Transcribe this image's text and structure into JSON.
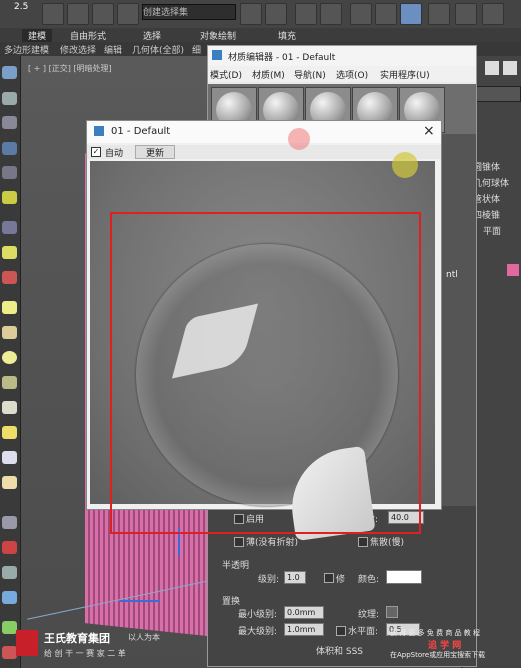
{
  "toolbar": {
    "version_text": "2.5",
    "dropdown_value": "创建选择集",
    "tabs": [
      "建模",
      "自由形式",
      "选择",
      "对象绘制",
      "填充"
    ]
  },
  "ribbon": {
    "items": [
      "多边形建模",
      "修改选择",
      "编辑",
      "几何体(全部)",
      "细"
    ]
  },
  "viewport": {
    "label": "[ + ] [正交] [明暗处理]"
  },
  "right_panel": {
    "items": [
      "圆锥体",
      "几何球体",
      "管状体",
      "四棱锥",
      "平面"
    ],
    "accent_color": "#e06aa0"
  },
  "material_editor": {
    "title": "材质编辑器 - 01 - Default",
    "menus": [
      "模式(D)",
      "材质(M)",
      "导航(N)",
      "选项(O)",
      "实用程序(U)"
    ],
    "side_label": "ntl",
    "lower": {
      "enable_label": "启用",
      "abbe_label": "阿贝数:",
      "abbe_value": "40.0",
      "thin_wall_label": "薄(没有折射)",
      "caustics_label": "焦散(慢)",
      "translucency_header": "半透明",
      "level_label": "级别:",
      "level_value": "1.0",
      "modify_label": "修",
      "color_label": "颜色:",
      "displacement_header": "置换",
      "min_level_label": "最小级别:",
      "min_level_value": "0.0mm",
      "texture_label": "纹理:",
      "max_level_label": "最大级别:",
      "max_level_value": "1.0mm",
      "horizontal_label": "水平面:",
      "horizontal_value": "0.5",
      "sss_label": "体积和 SSS"
    }
  },
  "preview": {
    "title": "01 - Default",
    "auto_label": "自动",
    "update_label": "更新",
    "close_glyph": "×"
  },
  "watermark": {
    "brand": "王氏教育集团",
    "slogan": "以人为本",
    "sub": "给 创 干 一 赛 家 二 革",
    "right_title": "获 得 更 多 免 费 商 品 教 程",
    "right_brand": "追 学 网",
    "right_sub": "在AppStore或应用宝搜索下载"
  }
}
